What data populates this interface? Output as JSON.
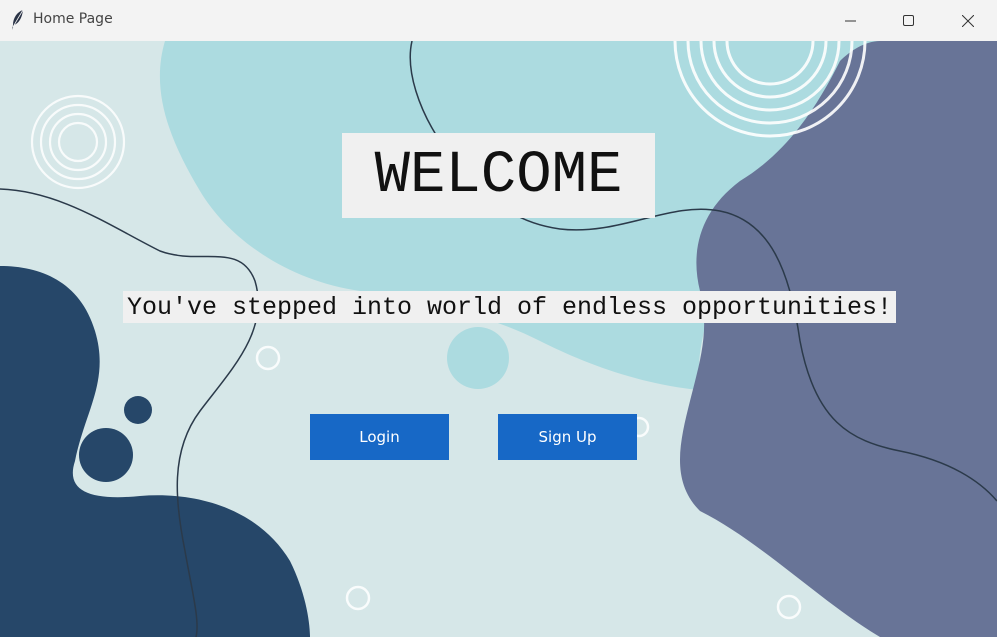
{
  "window": {
    "title": "Home Page",
    "app_icon": "feather-icon",
    "controls": {
      "minimize": "minimize-icon",
      "maximize": "maximize-icon",
      "close": "close-icon"
    }
  },
  "main": {
    "heading": "WELCOME",
    "tagline": "You've stepped into world of endless opportunities!",
    "login_label": "Login",
    "signup_label": "Sign Up"
  },
  "colors": {
    "button": "#1768c6",
    "background_light": "#d6e7e8",
    "blob_teal": "#acdbe0",
    "blob_slate": "#687497",
    "blob_navy": "#264769"
  }
}
